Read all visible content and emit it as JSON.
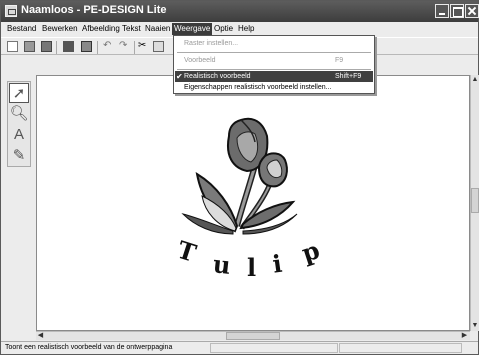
{
  "window": {
    "title": "Naamloos - PE-DESIGN Lite"
  },
  "menubar": {
    "items": [
      {
        "label": "Bestand"
      },
      {
        "label": "Bewerken"
      },
      {
        "label": "Afbeelding"
      },
      {
        "label": "Tekst"
      },
      {
        "label": "Naaien"
      },
      {
        "label": "Weergave"
      },
      {
        "label": "Optie"
      },
      {
        "label": "Help"
      }
    ]
  },
  "view_menu": {
    "items": [
      {
        "label": "Raster instellen...",
        "shortcut": "",
        "state": "disabled"
      },
      {
        "label": "Voorbeeld",
        "shortcut": "F9",
        "state": "disabled"
      },
      {
        "label": "Realistisch voorbeeld",
        "shortcut": "Shift+F9",
        "state": "checked-highlighted"
      },
      {
        "label": "Eigenschappen realistisch voorbeeld instellen...",
        "shortcut": "",
        "state": "normal"
      }
    ]
  },
  "canvas": {
    "design_text": "Tulip"
  },
  "statusbar": {
    "text": "Toont een realistisch voorbeeld van de ontwerppagina"
  },
  "colors": {
    "titlebar": "#4a4a4a",
    "menu_highlight": "#404040",
    "canvas": "#ffffff"
  },
  "icons": [
    "app-icon",
    "new-file-icon",
    "open-icon",
    "save-icon",
    "undo-icon",
    "redo-icon",
    "cut-icon",
    "copy-icon",
    "select-arrow-icon",
    "zoom-icon",
    "text-tool-icon",
    "stitch-tool-icon",
    "check-icon"
  ]
}
